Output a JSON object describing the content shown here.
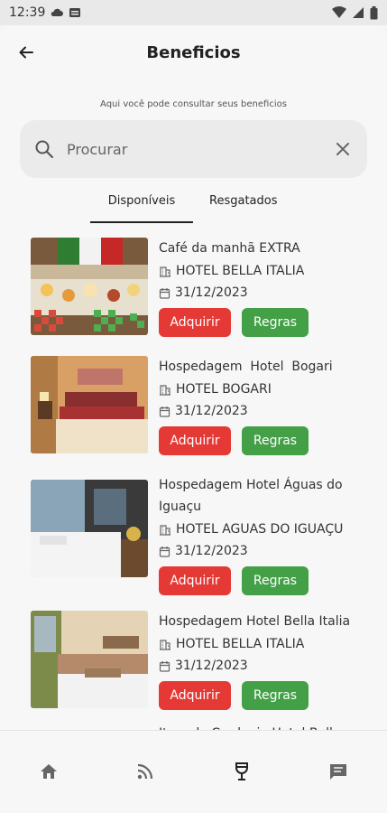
{
  "status_bar": {
    "time": "12:39"
  },
  "header": {
    "title": "Beneficios"
  },
  "subtitle": "Aqui você pode consultar seus beneficios",
  "search": {
    "placeholder": "Procurar"
  },
  "tabs": [
    {
      "label": "Disponíveis"
    },
    {
      "label": "Resgatados"
    }
  ],
  "items": [
    {
      "name": "Café da manhã EXTRA",
      "hotel": "HOTEL BELLA ITALIA",
      "date": "31/12/2023",
      "acquire": "Adquirir",
      "rules": "Regras"
    },
    {
      "name": "Hospedagem  Hotel  Bogari",
      "hotel": "HOTEL BOGARI",
      "date": "31/12/2023",
      "acquire": "Adquirir",
      "rules": "Regras"
    },
    {
      "name": "Hospedagem Hotel Águas do Iguaçu",
      "hotel": "HOTEL AGUAS DO IGUAÇU",
      "date": "31/12/2023",
      "acquire": "Adquirir",
      "rules": "Regras"
    },
    {
      "name": "Hospedagem Hotel Bella Italia",
      "hotel": "HOTEL BELLA ITALIA",
      "date": "31/12/2023",
      "acquire": "Adquirir",
      "rules": "Regras"
    },
    {
      "name": "Item do Cardapio Hotel Bella Italia"
    }
  ],
  "colors": {
    "acquire": "#e53935",
    "rules": "#43a047"
  },
  "nav": [
    {
      "icon": "home-icon"
    },
    {
      "icon": "rss-feed-icon"
    },
    {
      "icon": "wine-glass-icon"
    },
    {
      "icon": "chat-icon"
    }
  ]
}
